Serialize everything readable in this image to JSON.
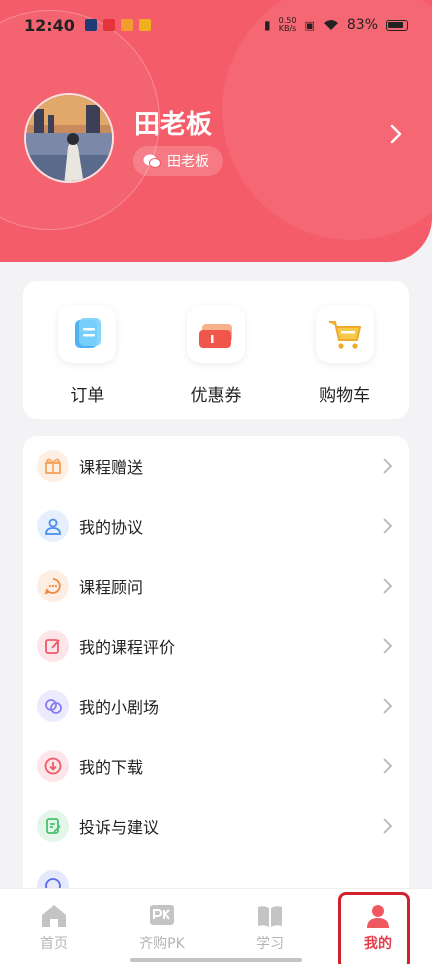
{
  "status_bar": {
    "time": "12:40",
    "speed_value": "0.50",
    "speed_unit": "KB/s",
    "battery": "83%"
  },
  "profile": {
    "name": "田老板",
    "wechat_name": "田老板"
  },
  "quick_actions": [
    {
      "label": "订单",
      "icon": "order-icon"
    },
    {
      "label": "优惠券",
      "icon": "coupon-icon"
    },
    {
      "label": "购物车",
      "icon": "cart-icon"
    }
  ],
  "menu": [
    {
      "label": "课程赠送",
      "icon": "gift-icon",
      "color": "#f5a35c"
    },
    {
      "label": "我的协议",
      "icon": "user-agreement-icon",
      "color": "#4a8ee8"
    },
    {
      "label": "课程顾问",
      "icon": "advisor-icon",
      "color": "#f0883c"
    },
    {
      "label": "我的课程评价",
      "icon": "review-icon",
      "color": "#ef5a6a"
    },
    {
      "label": "我的小剧场",
      "icon": "theater-icon",
      "color": "#8a7cf0"
    },
    {
      "label": "我的下载",
      "icon": "download-icon",
      "color": "#ef5a6a"
    },
    {
      "label": "投诉与建议",
      "icon": "feedback-icon",
      "color": "#47c26d"
    }
  ],
  "tabs": [
    {
      "label": "首页",
      "icon": "home-icon"
    },
    {
      "label": "齐购PK",
      "icon": "pk-icon"
    },
    {
      "label": "学习",
      "icon": "book-icon"
    },
    {
      "label": "我的",
      "icon": "profile-icon",
      "active": true
    }
  ],
  "colors": {
    "brand": "#f45c69",
    "active_tab": "#e33e4c"
  }
}
